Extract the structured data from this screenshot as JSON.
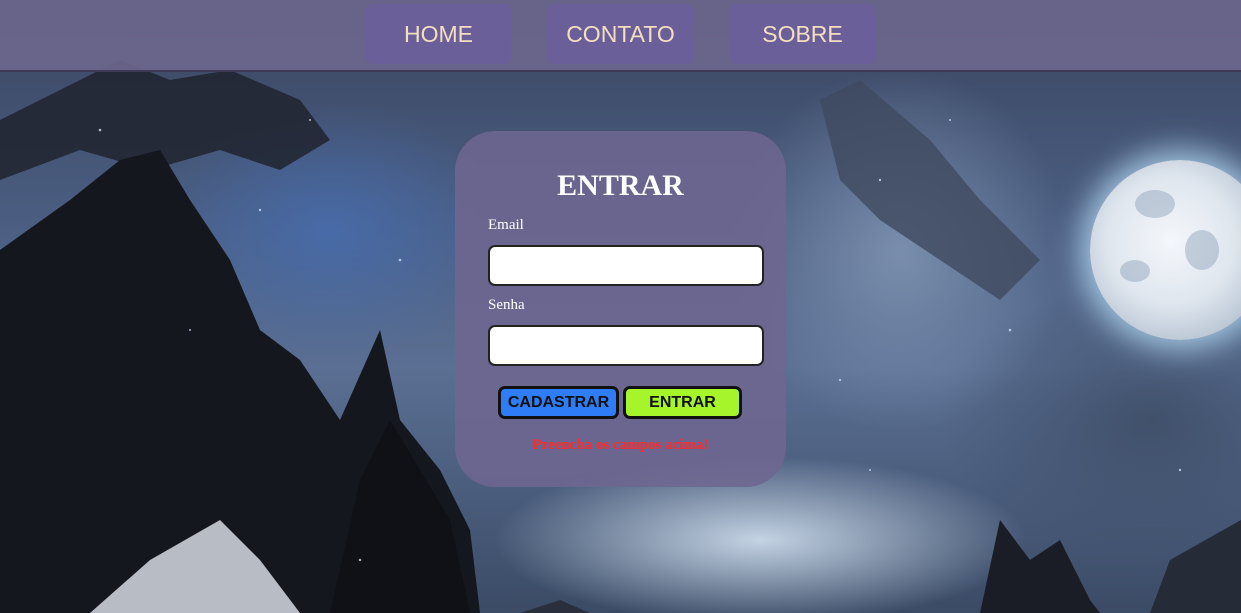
{
  "nav": {
    "items": [
      {
        "label": "HOME"
      },
      {
        "label": "CONTATO"
      },
      {
        "label": "SOBRE"
      }
    ]
  },
  "login": {
    "title": "ENTRAR",
    "email_label": "Email",
    "email_value": "",
    "password_label": "Senha",
    "password_value": "",
    "register_button": "CADASTRAR",
    "submit_button": "ENTRAR",
    "error_message": "Preencha os campos acima!"
  },
  "colors": {
    "nav_bar": "#6c668c",
    "nav_button": "#6a5f98",
    "nav_text": "#f3dfc0",
    "card": "#6e6691",
    "register_button": "#2f7df6",
    "submit_button": "#a6f52b",
    "error": "#ff2a2a"
  },
  "background": {
    "description_icon": "night-mountain-moon-landscape"
  }
}
